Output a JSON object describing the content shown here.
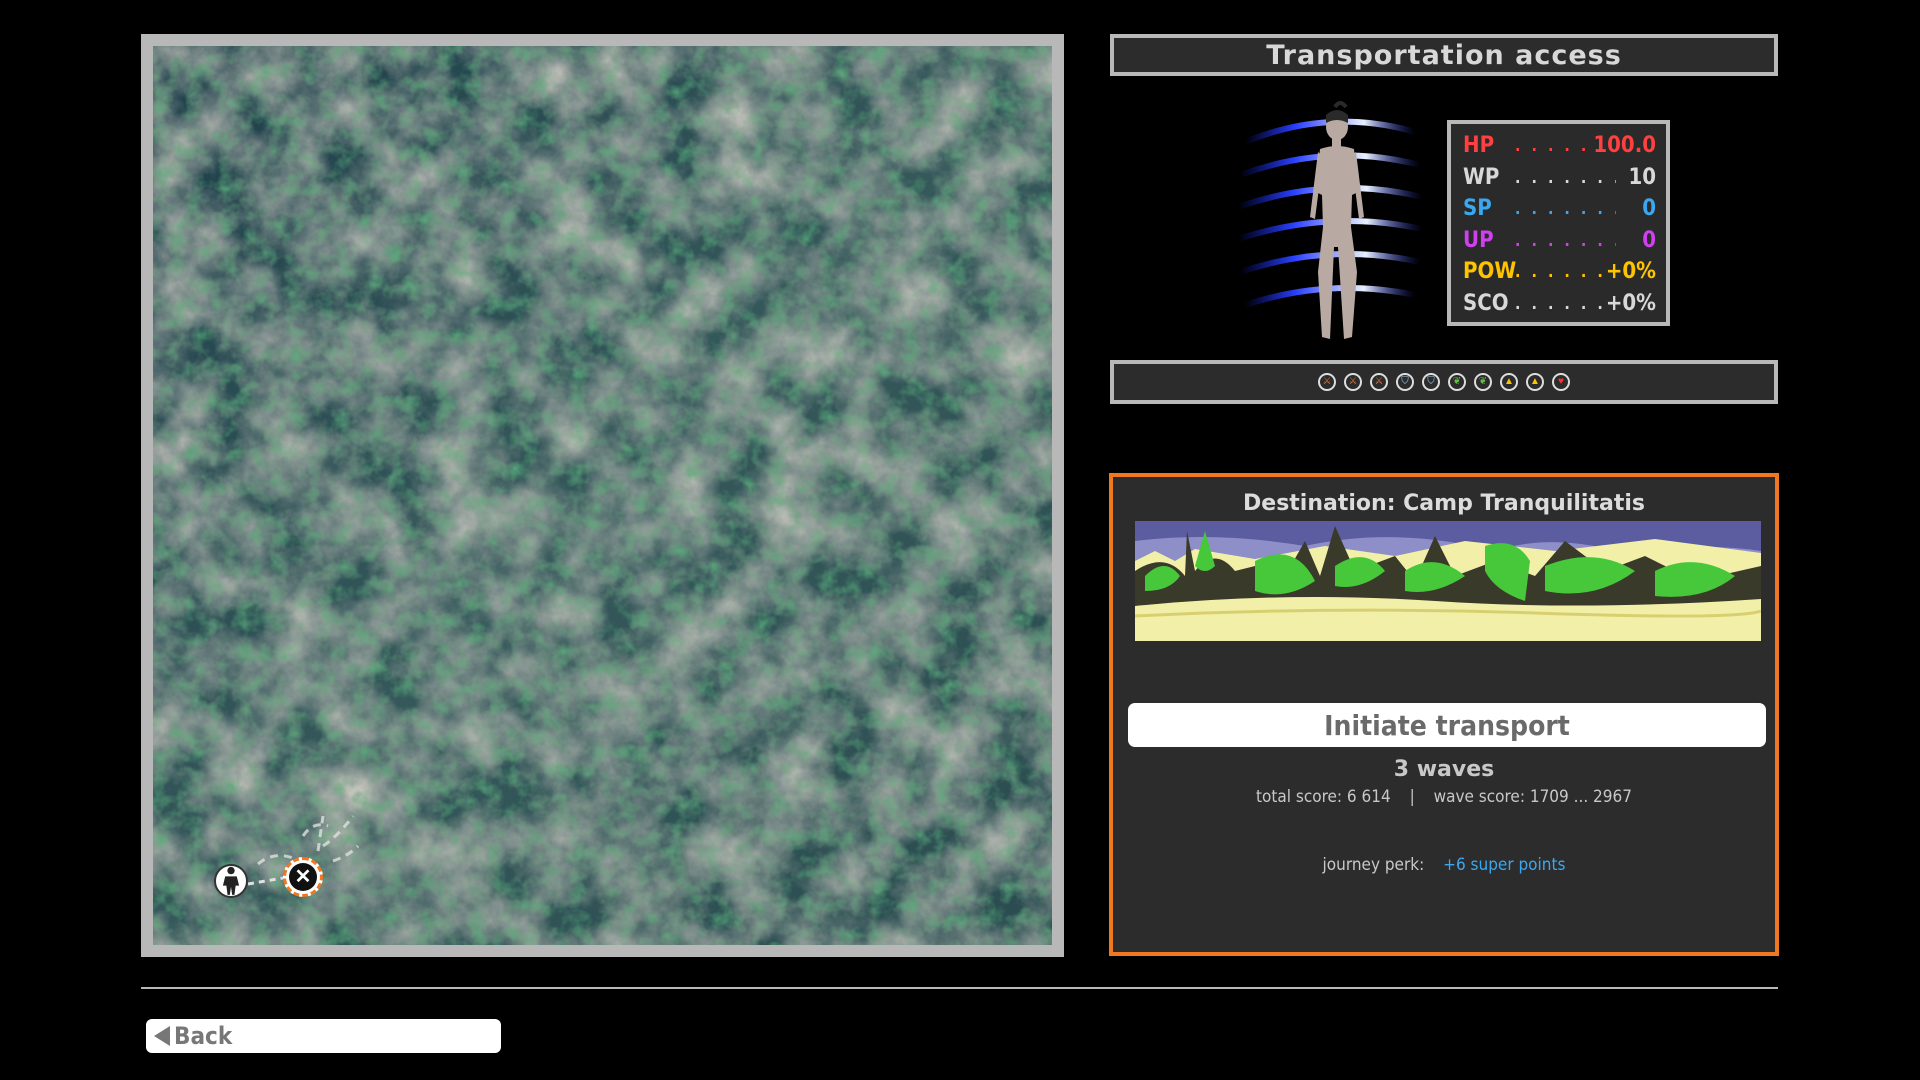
{
  "header": {
    "title": "Transportation access"
  },
  "stats": [
    {
      "label": "HP",
      "value": "100.0",
      "color": "#ff4040"
    },
    {
      "label": "WP",
      "value": "10",
      "color": "#d8d8d8"
    },
    {
      "label": "SP",
      "value": "0",
      "color": "#3aa8f0"
    },
    {
      "label": "UP",
      "value": "0",
      "color": "#d040f0"
    },
    {
      "label": "POW",
      "value": "+0%",
      "color": "#ffc400"
    },
    {
      "label": "SCO",
      "value": "+0%",
      "color": "#d8d8d8"
    }
  ],
  "buffs": [
    {
      "icon": "sword-buff-icon",
      "color": "#e0703a"
    },
    {
      "icon": "sword-buff-icon",
      "color": "#e0703a"
    },
    {
      "icon": "sword-buff-icon",
      "color": "#e0703a"
    },
    {
      "icon": "shield-buff-icon",
      "color": "#9ad0f0"
    },
    {
      "icon": "shield-buff-icon",
      "color": "#9ad0f0"
    },
    {
      "icon": "leaf-buff-icon",
      "color": "#60c040"
    },
    {
      "icon": "leaf-buff-icon",
      "color": "#60c040"
    },
    {
      "icon": "arrow-up-buff-icon",
      "color": "#ffc400"
    },
    {
      "icon": "arrow-up-buff-icon",
      "color": "#ffc400"
    },
    {
      "icon": "heart-buff-icon",
      "color": "#ff3030"
    }
  ],
  "destination": {
    "title": "Destination: Camp Tranquilitatis",
    "button_label": "Initiate transport",
    "waves": "3 waves",
    "total_score": "total score: 6 614",
    "separator": "|",
    "wave_score": "wave score: 1709 ... 2967",
    "perk_label": "journey perk:",
    "perk_value": "+6 super points"
  },
  "map": {
    "player_marker": "player-figure-icon",
    "destination_marker": "close-x-icon",
    "destination_symbol": "✕"
  },
  "footer": {
    "back_label": "Back"
  },
  "colors": {
    "accent": "#f07820",
    "frame": "#b8b8b8",
    "panel": "#2c2c2c"
  }
}
